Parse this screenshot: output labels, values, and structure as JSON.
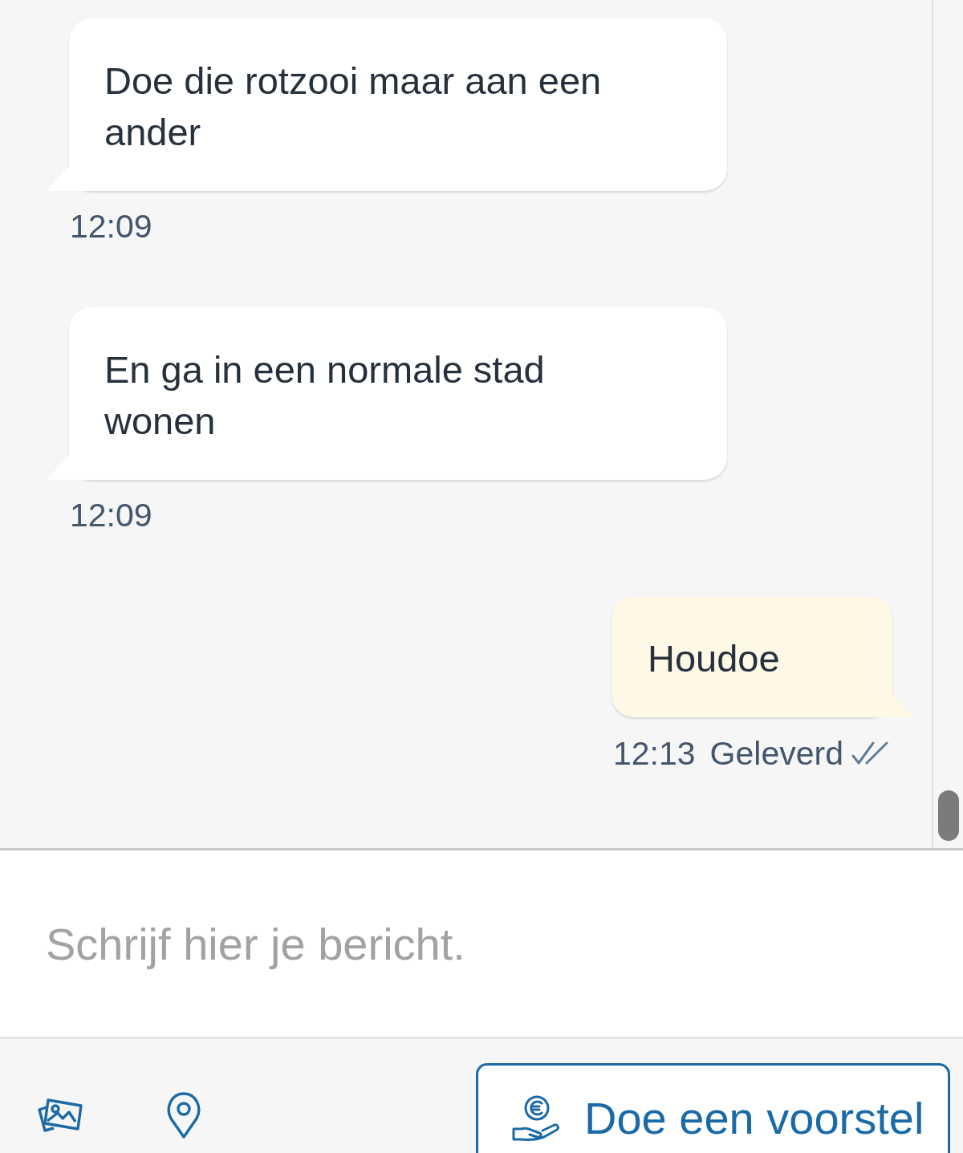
{
  "messages": [
    {
      "kind": "incoming",
      "text": "Doe die rotzooi maar aan een ander",
      "time": "12:09"
    },
    {
      "kind": "incoming",
      "text": "En ga in een normale stad wonen",
      "time": "12:09"
    },
    {
      "kind": "outgoing",
      "text": "Houdoe",
      "time": "12:13",
      "status": "Geleverd"
    }
  ],
  "composer": {
    "placeholder": "Schrijf hier je bericht."
  },
  "actions": {
    "offer_button": "Doe een voorstel"
  }
}
